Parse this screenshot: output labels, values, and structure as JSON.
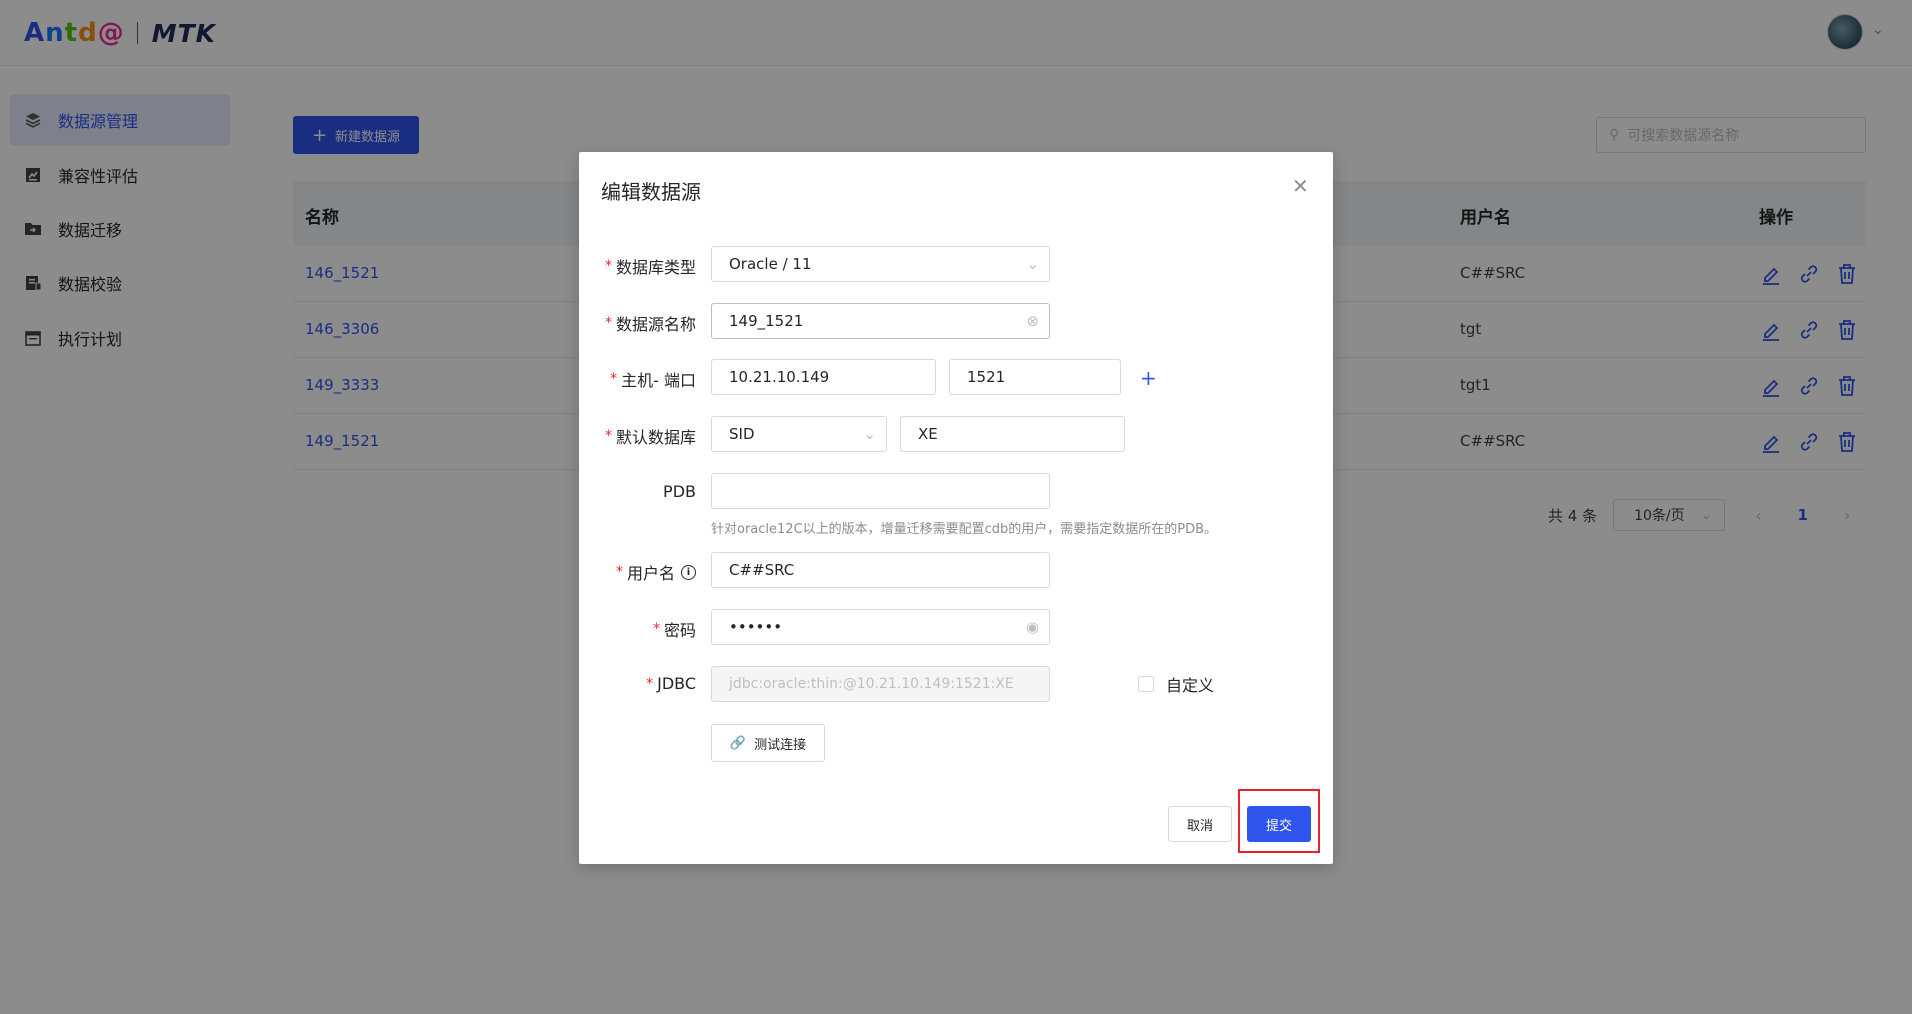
{
  "header": {
    "logo_parts": [
      "A",
      "n",
      "t",
      "d",
      "@"
    ],
    "logo_product": "MTK"
  },
  "sidebar": {
    "items": [
      {
        "label": "数据源管理",
        "icon": "layers-icon",
        "active": true
      },
      {
        "label": "兼容性评估",
        "icon": "chart-icon",
        "active": false
      },
      {
        "label": "数据迁移",
        "icon": "folder-icon",
        "active": false
      },
      {
        "label": "数据校验",
        "icon": "check-doc-icon",
        "active": false
      },
      {
        "label": "执行计划",
        "icon": "calendar-icon",
        "active": false
      }
    ]
  },
  "toolbar": {
    "new_button": "新建数据源",
    "search_placeholder": "可搜索数据源名称"
  },
  "table": {
    "columns": {
      "name": "名称",
      "user": "用户名",
      "ops": "操作"
    },
    "rows": [
      {
        "name": "146_1521",
        "user": "C##SRC"
      },
      {
        "name": "146_3306",
        "user": "tgt"
      },
      {
        "name": "149_3333",
        "user": "tgt1"
      },
      {
        "name": "149_1521",
        "user": "C##SRC"
      }
    ]
  },
  "pagination": {
    "total": "共 4 条",
    "page_size": "10条/页",
    "current": "1"
  },
  "modal": {
    "title": "编辑数据源",
    "fields": {
      "db_type": {
        "label": "数据库类型",
        "value": "Oracle / 11"
      },
      "ds_name": {
        "label": "数据源名称",
        "value": "149_1521"
      },
      "host_port": {
        "label": "主机- 端口",
        "host": "10.21.10.149",
        "port": "1521"
      },
      "default_db": {
        "label": "默认数据库",
        "type": "SID",
        "value": "XE"
      },
      "pdb": {
        "label": "PDB",
        "value": "",
        "hint": "针对oracle12C以上的版本，增量迁移需要配置cdb的用户，需要指定数据所在的PDB。"
      },
      "username": {
        "label": "用户名",
        "value": "C##SRC"
      },
      "password": {
        "label": "密码",
        "value": "••••••"
      },
      "jdbc": {
        "label": "JDBC",
        "value": "jdbc:oracle:thin:@10.21.10.149:1521:XE",
        "custom_label": "自定义"
      }
    },
    "test_button": "测试连接",
    "cancel_button": "取消",
    "submit_button": "提交"
  },
  "colors": {
    "primary": "#2f54eb",
    "required": "#f5222d",
    "highlight": "#e8202a"
  }
}
